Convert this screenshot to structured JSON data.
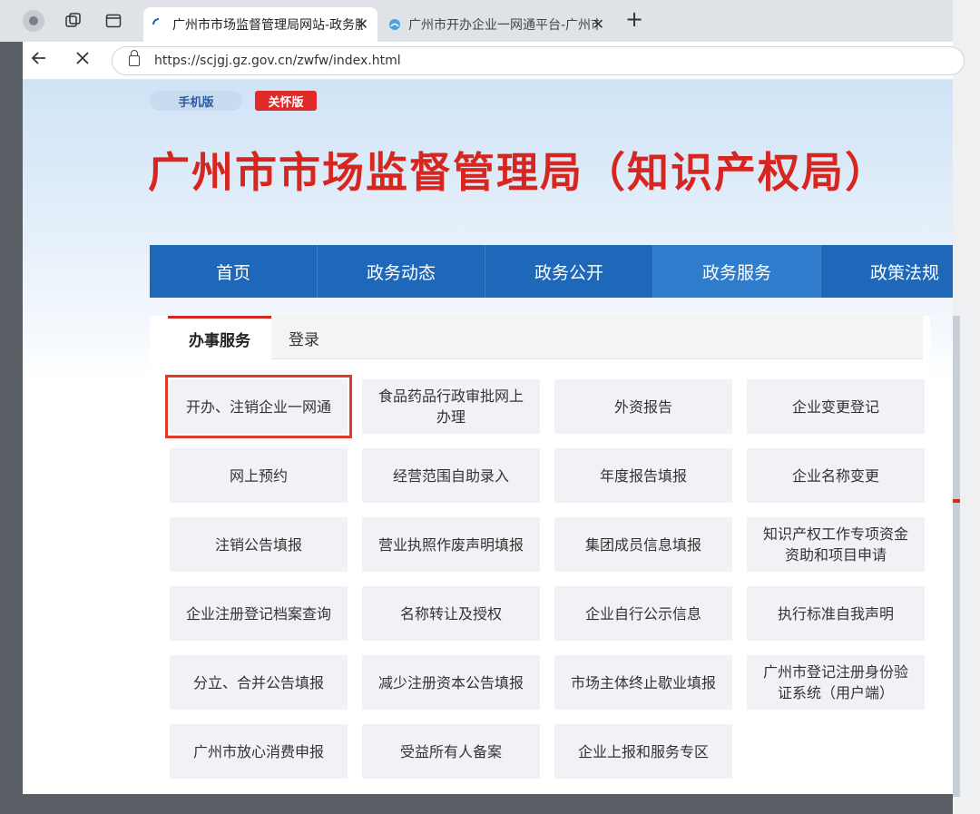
{
  "browser": {
    "tabs": [
      {
        "title": "广州市市场监督管理局网站-政务服务",
        "active": true
      },
      {
        "title": "广州市开办企业一网通平台-广州市",
        "active": false
      }
    ],
    "new_tab_label": "+",
    "close_glyph": "✕",
    "url": "https://scjgj.gz.gov.cn/zwfw/index.html"
  },
  "header": {
    "mobile_label": "手机版",
    "care_label": "关怀版",
    "title": "广州市市场监督管理局（知识产权局）"
  },
  "nav": {
    "items": [
      {
        "label": "首页",
        "active": false
      },
      {
        "label": "政务动态",
        "active": false
      },
      {
        "label": "政务公开",
        "active": false
      },
      {
        "label": "政务服务",
        "active": true
      },
      {
        "label": "政策法规",
        "active": false
      }
    ]
  },
  "services": {
    "tabs": [
      "办事服务",
      "登录"
    ],
    "items": [
      "开办、注销企业一网通",
      "食品药品行政审批网上办理",
      "外资报告",
      "企业变更登记",
      "网上预约",
      "经营范围自助录入",
      "年度报告填报",
      "企业名称变更",
      "注销公告填报",
      "营业执照作废声明填报",
      "集团成员信息填报",
      "知识产权工作专项资金资助和项目申请",
      "企业注册登记档案查询",
      "名称转让及授权",
      "企业自行公示信息",
      "执行标准自我声明",
      "分立、合并公告填报",
      "减少注册资本公告填报",
      "市场主体终止歇业填报",
      "广州市登记注册身份验证系统（用户端）",
      "广州市放心消费申报",
      "受益所有人备案",
      "企业上报和服务专区"
    ],
    "highlighted_index": 0
  },
  "colors": {
    "title_red": "#d7261f",
    "nav_blue": "#1f67b8",
    "highlight_red": "#e03a2c"
  }
}
